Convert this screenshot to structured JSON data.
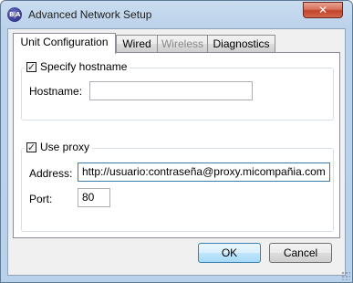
{
  "window": {
    "title": "Advanced Network Setup",
    "app_icon_text": "B|A",
    "close_glyph": "✕"
  },
  "tabs": [
    {
      "label": "Unit Configuration",
      "state": "active"
    },
    {
      "label": "Wired",
      "state": "normal"
    },
    {
      "label": "Wireless",
      "state": "disabled"
    },
    {
      "label": "Diagnostics",
      "state": "normal"
    }
  ],
  "hostname_group": {
    "checkbox_label": "Specify hostname",
    "checked": true,
    "check_glyph": "✓",
    "field_label": "Hostname:",
    "field_value": ""
  },
  "proxy_group": {
    "checkbox_label": "Use proxy",
    "checked": true,
    "check_glyph": "✓",
    "address_label": "Address:",
    "address_value": "http://usuario:contraseña@proxy.micompañia.com",
    "port_label": "Port:",
    "port_value": "80"
  },
  "buttons": {
    "ok_label": "OK",
    "cancel_label": "Cancel"
  },
  "colors": {
    "accent_border": "#3c7fb1",
    "close_button": "#c2432a",
    "window_frame": "#b9d1ea"
  }
}
